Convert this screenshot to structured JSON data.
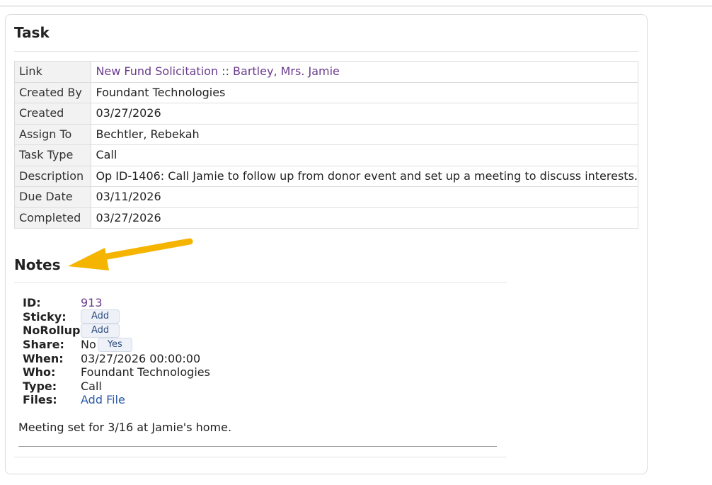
{
  "task": {
    "title": "Task",
    "rows": {
      "link": {
        "label": "Link",
        "primary": "New Fund Solicitation",
        "separator": "::",
        "secondary": "Bartley, Mrs. Jamie"
      },
      "created_by": {
        "label": "Created By",
        "value": "Foundant Technologies"
      },
      "created": {
        "label": "Created",
        "value": "03/27/2026"
      },
      "assign_to": {
        "label": "Assign To",
        "value": "Bechtler, Rebekah"
      },
      "task_type": {
        "label": "Task Type",
        "value": "Call"
      },
      "description": {
        "label": "Description",
        "value": "Op ID-1406: Call Jamie to follow up from donor event and set up a meeting to discuss interests."
      },
      "due_date": {
        "label": "Due Date",
        "value": "03/11/2026"
      },
      "completed": {
        "label": "Completed",
        "value": "03/27/2026"
      }
    }
  },
  "notes": {
    "title": "Notes",
    "id": {
      "label": "ID:",
      "value": "913"
    },
    "sticky": {
      "label": "Sticky:",
      "button": "Add"
    },
    "norollup": {
      "label": "NoRollup:",
      "button": "Add"
    },
    "share": {
      "label": "Share:",
      "value": "No",
      "button": "Yes"
    },
    "when": {
      "label": "When:",
      "value": "03/27/2026 00:00:00"
    },
    "who": {
      "label": "Who:",
      "value": "Foundant Technologies"
    },
    "type": {
      "label": "Type:",
      "value": "Call"
    },
    "files": {
      "label": "Files:",
      "link": "Add File"
    },
    "body": "Meeting set for 3/16 at Jamie's home."
  },
  "annotation": {
    "arrow_color": "#f5b400",
    "icon": "arrow-annotation-icon"
  },
  "colors": {
    "link_purple": "#6a3b8c",
    "link_blue": "#2a5aa5",
    "label_bg": "#f2f2f2"
  }
}
